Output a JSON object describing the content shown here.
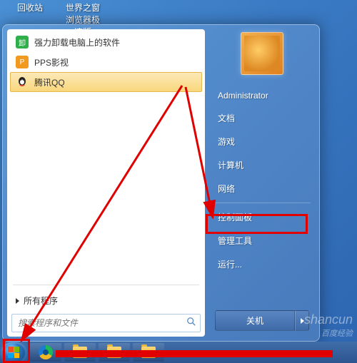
{
  "desktop": {
    "icons": [
      "回收站",
      "世界之窗浏览器极速版"
    ]
  },
  "start_menu": {
    "programs": [
      {
        "label": "强力卸载电脑上的软件",
        "icon_color": "#2eaf4a"
      },
      {
        "label": "PPS影视",
        "icon_color": "#f29a1f"
      },
      {
        "label": "腾讯QQ",
        "icon_color": "#e03030",
        "selected": true
      }
    ],
    "all_programs": "所有程序",
    "search_placeholder": "搜索程序和文件"
  },
  "right_menu": {
    "user": "Administrator",
    "items_1": [
      "文档",
      "游戏",
      "计算机",
      "网络"
    ],
    "items_2": [
      "控制面板",
      "管理工具",
      "运行..."
    ],
    "shutdown": "关机"
  },
  "watermark": {
    "main": "shancun",
    "sub": "百度经验"
  }
}
